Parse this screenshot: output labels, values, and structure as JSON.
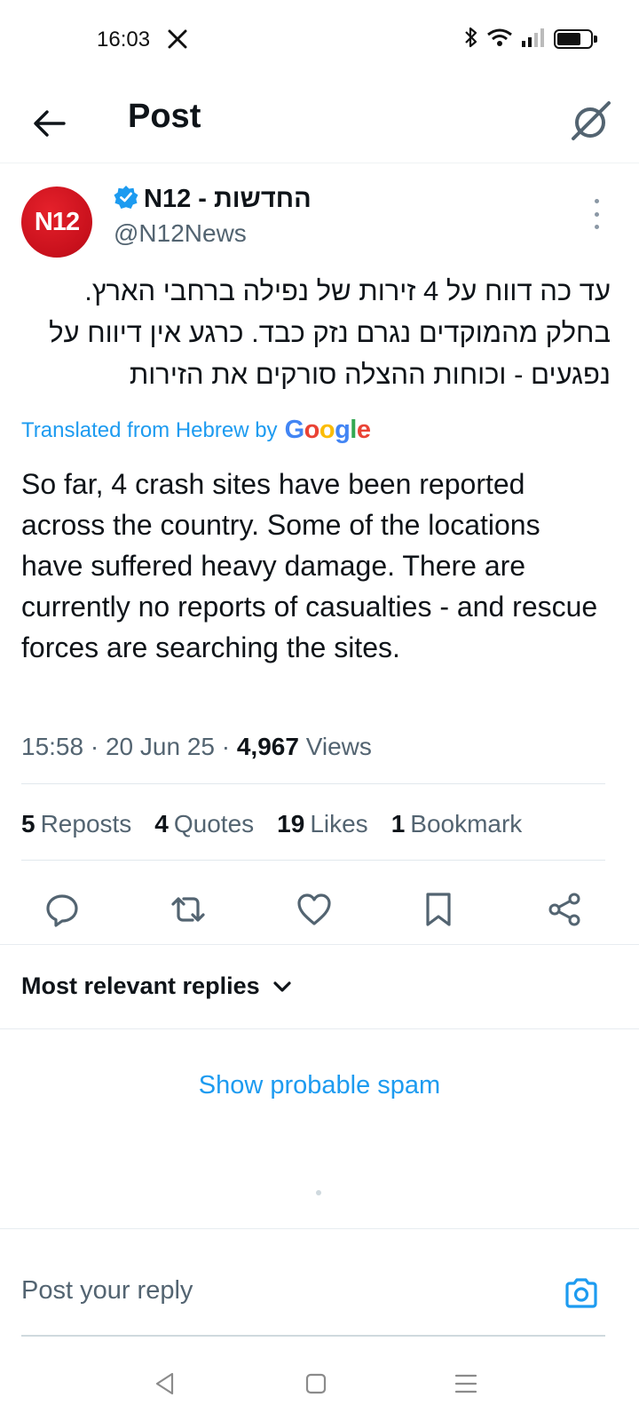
{
  "status_bar": {
    "time": "16:03",
    "battery_level": 0.75,
    "icons": [
      "x-app-icon",
      "bluetooth-icon",
      "wifi-icon",
      "signal-icon",
      "battery-icon"
    ]
  },
  "header": {
    "title": "Post",
    "back_icon": "arrow-left-icon",
    "grok_icon": "grok-icon"
  },
  "author": {
    "avatar_text": "N12",
    "name": "N12 - החדשות",
    "verified": true,
    "handle": "@N12News"
  },
  "post": {
    "hebrew_text": "עד כה דווח על 4 זירות של נפילה ברחבי הארץ. בחלק מהמוקדים נגרם נזק כבד. כרגע אין דיווח על נפגעים - וכוחות ההצלה סורקים את הזירות",
    "translated_label": "Translated from Hebrew by",
    "google_label": "Google",
    "english_text": "So far, 4 crash sites have been reported across the country. Some of the locations have suffered heavy damage. There are currently no reports of casualties - and rescue forces are searching the sites.",
    "time": "15:58",
    "date": "20 Jun 25",
    "views_count": "4,967",
    "views_label": "Views",
    "separator": "·"
  },
  "stats": [
    {
      "count": "5",
      "label": "Reposts"
    },
    {
      "count": "4",
      "label": "Quotes"
    },
    {
      "count": "19",
      "label": "Likes"
    },
    {
      "count": "1",
      "label": "Bookmark"
    }
  ],
  "actions": [
    "reply-icon",
    "repost-icon",
    "like-icon",
    "bookmark-icon",
    "share-icon"
  ],
  "replies": {
    "sort_label": "Most relevant replies",
    "spam_label": "Show probable spam"
  },
  "reply_bar": {
    "placeholder": "Post your reply"
  },
  "colors": {
    "accent": "#1d9bf0",
    "text": "#0f1419",
    "secondary": "#536471",
    "avatar_red": "#d7141f"
  }
}
